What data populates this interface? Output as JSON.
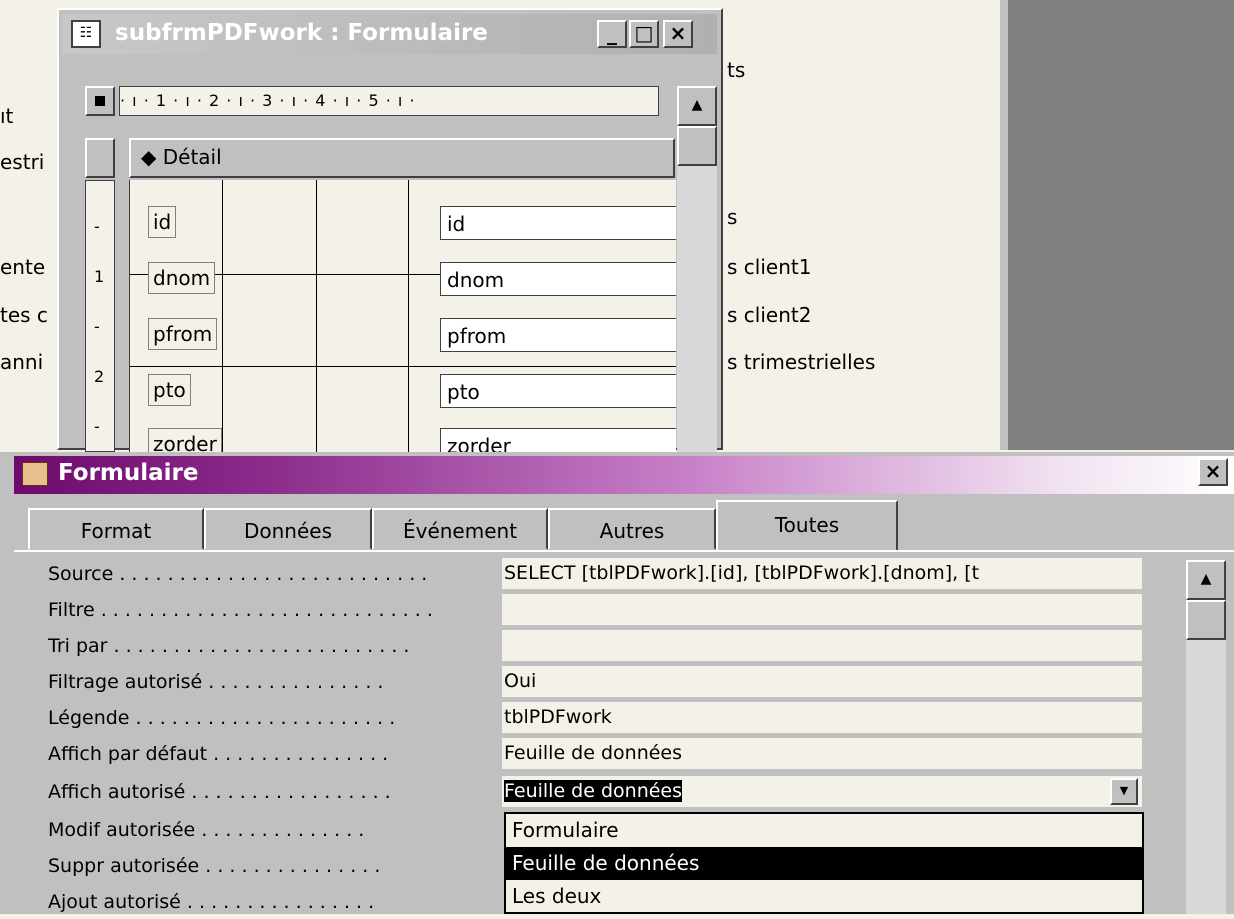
{
  "background": {
    "left_items": [
      "ıt",
      "estri",
      "ente",
      "tes c",
      "anni"
    ],
    "right_items": [
      "ts",
      "s",
      "s client1",
      "s client2",
      "s trimestrielles"
    ]
  },
  "subform": {
    "title": "subfrmPDFwork : Formulaire",
    "ruler": "· ı · 1 · ı · 2 · ı · 3 · ı · 4 · ı · 5 · ı ·",
    "vruler_marks": [
      "-",
      "1",
      "-",
      "2",
      "-"
    ],
    "section": "Détail",
    "fields": [
      {
        "label": "id",
        "control": "id"
      },
      {
        "label": "dnom",
        "control": "dnom"
      },
      {
        "label": "pfrom",
        "control": "pfrom"
      },
      {
        "label": "pto",
        "control": "pto"
      },
      {
        "label": "zorder",
        "control": "zorder"
      }
    ]
  },
  "properties": {
    "title": "Formulaire",
    "tabs": [
      "Format",
      "Données",
      "Événement",
      "Autres",
      "Toutes"
    ],
    "active_tab": "Toutes",
    "rows": [
      {
        "name": "Source",
        "value": "SELECT [tblPDFwork].[id], [tblPDFwork].[dnom], [t"
      },
      {
        "name": "Filtre",
        "value": ""
      },
      {
        "name": "Tri par",
        "value": ""
      },
      {
        "name": "Filtrage autorisé",
        "value": "Oui"
      },
      {
        "name": "Légende",
        "value": "tblPDFwork"
      },
      {
        "name": "Affich par défaut",
        "value": "Feuille de données"
      },
      {
        "name": "Affich autorisé",
        "value": "Feuille de données"
      },
      {
        "name": "Modif autorisée",
        "value": ""
      },
      {
        "name": "Suppr autorisée",
        "value": ""
      },
      {
        "name": "Ajout autorisé",
        "value": ""
      }
    ],
    "dropdown_options": [
      "Formulaire",
      "Feuille de données",
      "Les deux"
    ],
    "dropdown_selected": "Feuille de données"
  },
  "icons": {
    "form_icon": "form-icon",
    "properties_icon": "properties-icon",
    "close": "×",
    "minimize": "_",
    "maximize": "□",
    "scroll_up": "▲",
    "dropdown_arrow": "▼",
    "section_marker": "◆"
  },
  "colors": {
    "title_bar_active": "#6e0a6e",
    "field_background": "#f4f1e8",
    "selection": "#000000"
  }
}
